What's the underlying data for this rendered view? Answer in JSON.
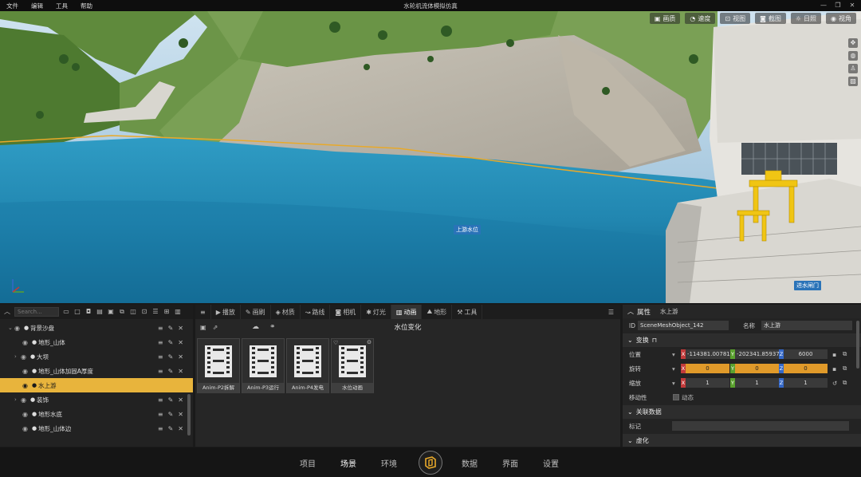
{
  "menu": [
    "文件",
    "编辑",
    "工具",
    "帮助"
  ],
  "app_title": "水轮机流体模拟仿真",
  "window_controls": [
    "—",
    "❐",
    "✕"
  ],
  "viewport": {
    "toolbar": [
      {
        "icon": "image-icon",
        "label": "画质"
      },
      {
        "icon": "speed-icon",
        "label": "速度"
      },
      {
        "icon": "view-icon",
        "label": "视图"
      },
      {
        "icon": "screenshot-icon",
        "label": "截图"
      },
      {
        "icon": "sun-icon",
        "label": "日照"
      },
      {
        "icon": "eye-icon",
        "label": "视角"
      }
    ],
    "labels": {
      "upstream_level": "上游水位",
      "intake": "进水闸门"
    }
  },
  "outliner": {
    "search_placeholder": "Search...",
    "items": [
      {
        "label": "背景沙盘",
        "depth": 1,
        "expanded": true,
        "selected": false
      },
      {
        "label": "地形_山体",
        "depth": 2,
        "expanded": false,
        "selected": false
      },
      {
        "label": "大坝",
        "depth": 2,
        "expanded": false,
        "selected": false,
        "collapsed": true
      },
      {
        "label": "地形_山体加固A厚度",
        "depth": 2,
        "expanded": false,
        "selected": false
      },
      {
        "label": "水上游",
        "depth": 2,
        "expanded": false,
        "selected": true
      },
      {
        "label": "装饰",
        "depth": 2,
        "expanded": false,
        "selected": false,
        "collapsed": true
      },
      {
        "label": "地形水底",
        "depth": 2,
        "expanded": false,
        "selected": false
      },
      {
        "label": "地形_山体边",
        "depth": 2,
        "expanded": false,
        "selected": false
      }
    ]
  },
  "content": {
    "tabs": [
      {
        "icon": "menu-icon",
        "label": ""
      },
      {
        "icon": "play-icon",
        "label": "播放"
      },
      {
        "icon": "brush-icon",
        "label": "画刷"
      },
      {
        "icon": "material-icon",
        "label": "材质"
      },
      {
        "icon": "path-icon",
        "label": "路线"
      },
      {
        "icon": "camera-icon",
        "label": "相机"
      },
      {
        "icon": "light-icon",
        "label": "灯光"
      },
      {
        "icon": "animation-icon",
        "label": "动画",
        "active": true
      },
      {
        "icon": "terrain-icon",
        "label": "地形"
      },
      {
        "icon": "tool-icon",
        "label": "工具"
      }
    ],
    "title": "水位变化",
    "assets": [
      "Anim-P2拆解",
      "Anim-P3运行",
      "Anim-P4发电",
      "水位动画"
    ]
  },
  "properties": {
    "header": "属性",
    "header_name": "水上游",
    "id_label": "ID",
    "id_value": "SceneMeshObject_142",
    "name_label": "名称",
    "name_value": "水上游",
    "transform_section": "变换",
    "position_label": "位置",
    "position": {
      "x": "-114381.007812",
      "y": "-202341.859375",
      "z": "6000"
    },
    "rotation_label": "旋转",
    "rotation": {
      "x": "0",
      "y": "0",
      "z": "0"
    },
    "scale_label": "缩放",
    "scale": {
      "x": "1",
      "y": "1",
      "z": "1"
    },
    "mobility_label": "移动性",
    "mobility_value": "动态",
    "related_section": "关联数据",
    "tag_label": "标记",
    "virtual_section": "虚化"
  },
  "bottom_nav": [
    {
      "label": "项目",
      "active": false
    },
    {
      "label": "场景",
      "active": true
    },
    {
      "label": "环境",
      "active": false
    },
    {
      "label": "数据",
      "active": false
    },
    {
      "label": "界面",
      "active": false
    },
    {
      "label": "设置",
      "active": false
    }
  ],
  "colors": {
    "accent": "#e8b43c",
    "selected_row": "#e8b43c",
    "axis_x": "#c23a3a",
    "axis_y": "#5aa12e",
    "axis_z": "#3468c8"
  }
}
